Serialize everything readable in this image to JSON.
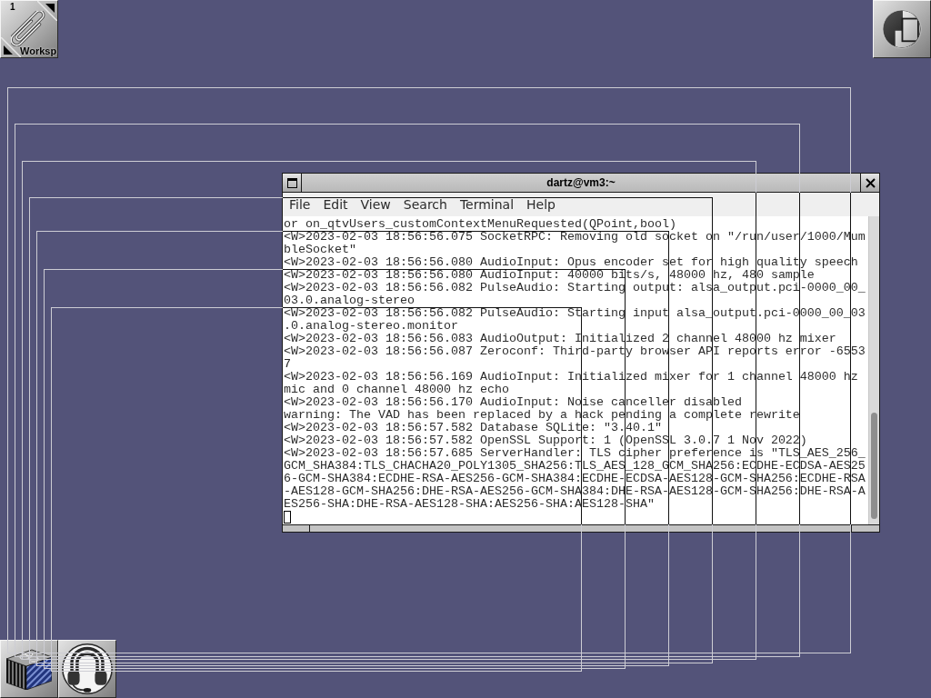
{
  "clip": {
    "workspace_number": "1",
    "workspace_name": "Worksp"
  },
  "terminal": {
    "title": "dartz@vm3:~",
    "focused": false,
    "menu": [
      "File",
      "Edit",
      "View",
      "Search",
      "Terminal",
      "Help"
    ],
    "lines": [
      "or on_qtvUsers_customContextMenuRequested(QPoint,bool)",
      "<W>2023-02-03 18:56:56.075 SocketRPC: Removing old socket on \"/run/user/1000/MumbleSocket\"",
      "<W>2023-02-03 18:56:56.080 AudioInput: Opus encoder set for high quality speech",
      "<W>2023-02-03 18:56:56.080 AudioInput: 40000 bits/s, 48000 hz, 480 sample",
      "<W>2023-02-03 18:56:56.082 PulseAudio: Starting output: alsa_output.pci-0000_00_03.0.analog-stereo",
      "<W>2023-02-03 18:56:56.082 PulseAudio: Starting input alsa_output.pci-0000_00_03.0.analog-stereo.monitor",
      "<W>2023-02-03 18:56:56.083 AudioOutput: Initialized 2 channel 48000 hz mixer",
      "<W>2023-02-03 18:56:56.087 Zeroconf: Third-party browser API reports error -65537",
      "<W>2023-02-03 18:56:56.169 AudioInput: Initialized mixer for 1 channel 48000 hz mic and 0 channel 48000 hz echo",
      "<W>2023-02-03 18:56:56.170 AudioInput: Noise canceller disabled",
      "warning: The VAD has been replaced by a hack pending a complete rewrite",
      "<W>2023-02-03 18:56:57.582 Database SQLite: \"3.40.1\"",
      "<W>2023-02-03 18:56:57.582 OpenSSL Support: 1 (OpenSSL 3.0.7 1 Nov 2022)",
      "<W>2023-02-03 18:56:57.685 ServerHandler: TLS cipher preference is \"TLS_AES_256_GCM_SHA384:TLS_CHACHA20_POLY1305_SHA256:TLS_AES_128_GCM_SHA256:ECDHE-ECDSA-AES256-GCM-SHA384:ECDHE-RSA-AES256-GCM-SHA384:ECDHE-ECDSA-AES128-GCM-SHA256:ECDHE-RSA-AES128-GCM-SHA256:DHE-RSA-AES256-GCM-SHA384:DHE-RSA-AES128-GCM-SHA256:DHE-RSA-AES256-SHA:DHE-RSA-AES128-SHA:AES256-SHA:AES128-SHA\""
    ]
  }
}
